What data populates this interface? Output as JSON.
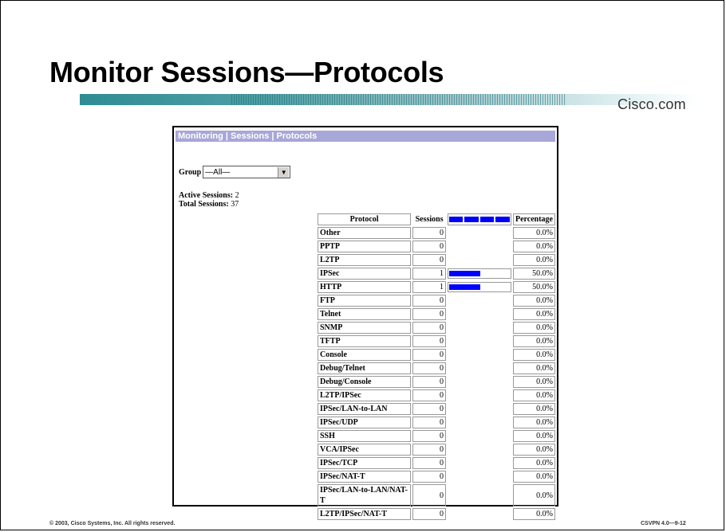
{
  "slide": {
    "title": "Monitor Sessions—Protocols",
    "brand": "Cisco.com",
    "footer_left": "© 2003, Cisco Systems, Inc. All rights reserved.",
    "footer_right": "CSVPN 4.0—9-12"
  },
  "screen": {
    "breadcrumb": "Monitoring | Sessions | Protocols",
    "group_label": "Group",
    "group_value": "—All—",
    "active_label": "Active Sessions:",
    "active_value": "2",
    "total_label": "Total Sessions:",
    "total_value": "37",
    "headers": {
      "protocol": "Protocol",
      "sessions": "Sessions",
      "percentage": "Percentage"
    },
    "rows": [
      {
        "protocol": "Other",
        "sessions": "0",
        "percentage": "0.0%",
        "fraction": 0
      },
      {
        "protocol": "PPTP",
        "sessions": "0",
        "percentage": "0.0%",
        "fraction": 0
      },
      {
        "protocol": "L2TP",
        "sessions": "0",
        "percentage": "0.0%",
        "fraction": 0
      },
      {
        "protocol": "IPSec",
        "sessions": "1",
        "percentage": "50.0%",
        "fraction": 0.5
      },
      {
        "protocol": "HTTP",
        "sessions": "1",
        "percentage": "50.0%",
        "fraction": 0.5
      },
      {
        "protocol": "FTP",
        "sessions": "0",
        "percentage": "0.0%",
        "fraction": 0
      },
      {
        "protocol": "Telnet",
        "sessions": "0",
        "percentage": "0.0%",
        "fraction": 0
      },
      {
        "protocol": "SNMP",
        "sessions": "0",
        "percentage": "0.0%",
        "fraction": 0
      },
      {
        "protocol": "TFTP",
        "sessions": "0",
        "percentage": "0.0%",
        "fraction": 0
      },
      {
        "protocol": "Console",
        "sessions": "0",
        "percentage": "0.0%",
        "fraction": 0
      },
      {
        "protocol": "Debug/Telnet",
        "sessions": "0",
        "percentage": "0.0%",
        "fraction": 0
      },
      {
        "protocol": "Debug/Console",
        "sessions": "0",
        "percentage": "0.0%",
        "fraction": 0
      },
      {
        "protocol": "L2TP/IPSec",
        "sessions": "0",
        "percentage": "0.0%",
        "fraction": 0
      },
      {
        "protocol": "IPSec/LAN-to-LAN",
        "sessions": "0",
        "percentage": "0.0%",
        "fraction": 0
      },
      {
        "protocol": "IPSec/UDP",
        "sessions": "0",
        "percentage": "0.0%",
        "fraction": 0
      },
      {
        "protocol": "SSH",
        "sessions": "0",
        "percentage": "0.0%",
        "fraction": 0
      },
      {
        "protocol": "VCA/IPSec",
        "sessions": "0",
        "percentage": "0.0%",
        "fraction": 0
      },
      {
        "protocol": "IPSec/TCP",
        "sessions": "0",
        "percentage": "0.0%",
        "fraction": 0
      },
      {
        "protocol": "IPSec/NAT-T",
        "sessions": "0",
        "percentage": "0.0%",
        "fraction": 0
      },
      {
        "protocol": "IPSec/LAN-to-LAN/NAT-T",
        "sessions": "0",
        "percentage": "0.0%",
        "fraction": 0
      },
      {
        "protocol": "L2TP/IPSec/NAT-T",
        "sessions": "0",
        "percentage": "0.0%",
        "fraction": 0
      }
    ]
  },
  "colors": {
    "bar": "#0000ff",
    "breadcrumb_bg": "#a7a7d8"
  }
}
